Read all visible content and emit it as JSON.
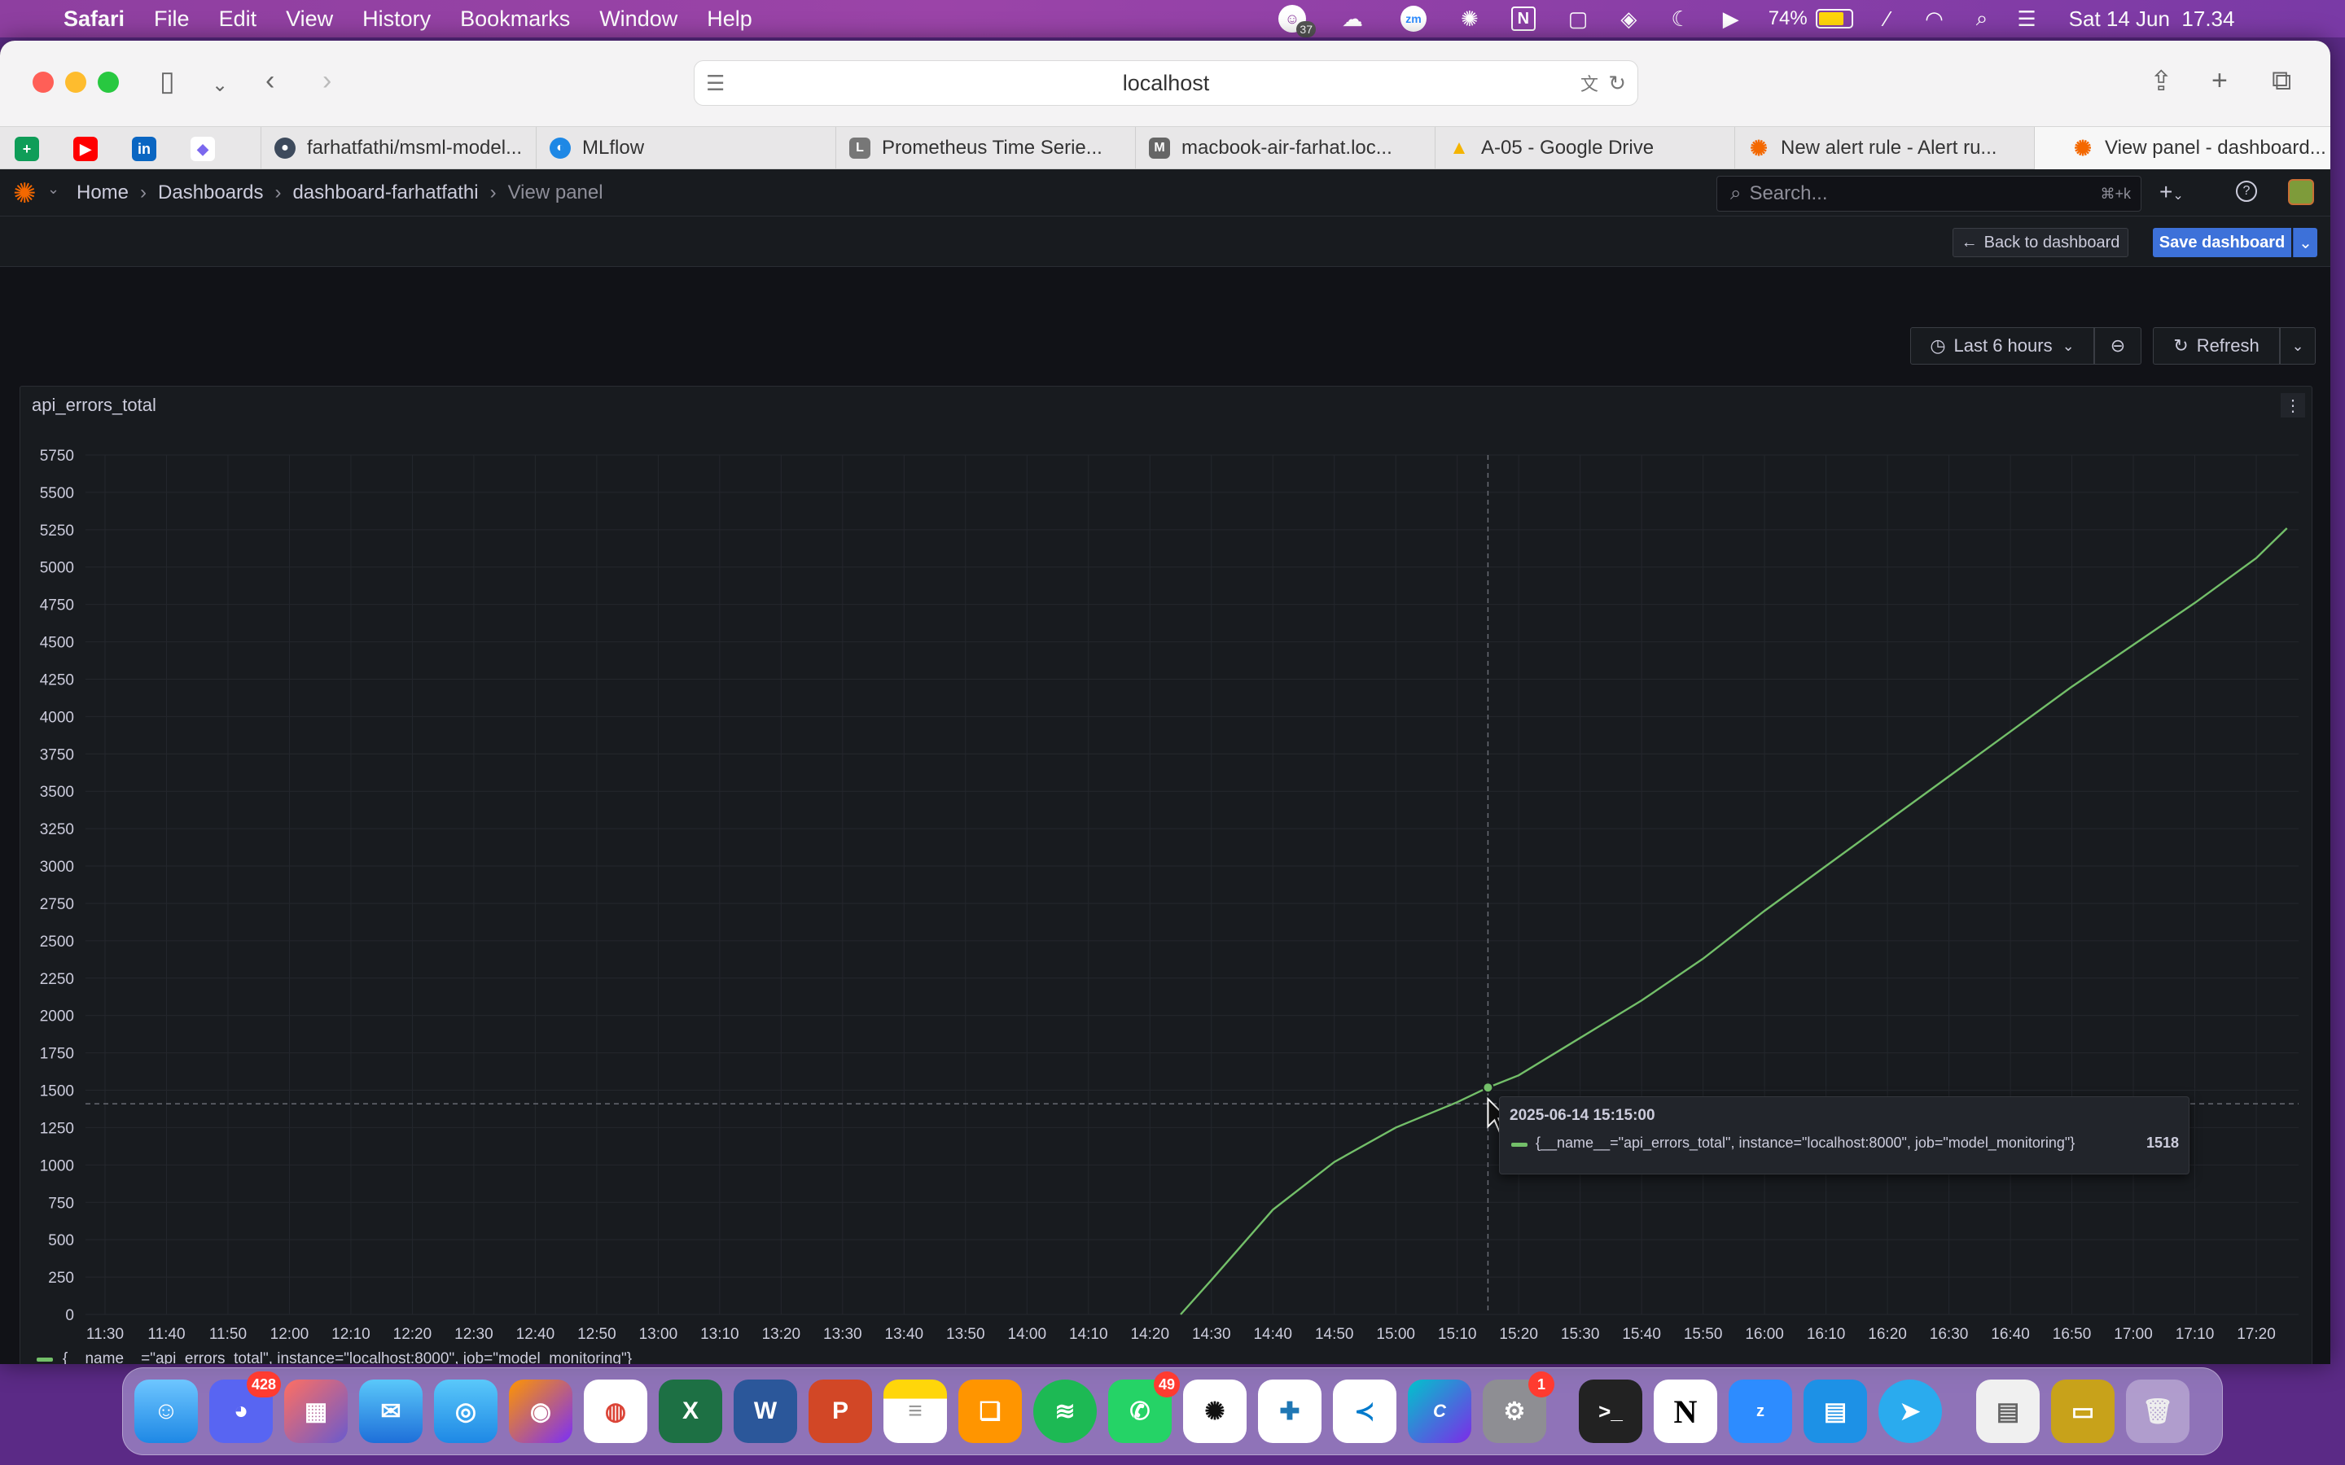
{
  "menubar": {
    "app": "Safari",
    "items": [
      "File",
      "Edit",
      "View",
      "History",
      "Bookmarks",
      "Window",
      "Help"
    ],
    "battery": "74%",
    "datetime": "Sat 14 Jun  17.34",
    "badge_count": "37"
  },
  "browser": {
    "address": "localhost",
    "tabs": [
      {
        "label": "farhatfathi/msml-model...",
        "color": "#3d4a5c"
      },
      {
        "label": "MLflow",
        "color": "#1e88e5"
      },
      {
        "label": "Prometheus Time Serie...",
        "color": "#777777"
      },
      {
        "label": "macbook-air-farhat.loc...",
        "color": "#666666"
      },
      {
        "label": "A-05 - Google Drive",
        "color": "#f4b400"
      },
      {
        "label": "New alert rule - Alert ru...",
        "color": "#f46800"
      },
      {
        "label": "View panel - dashboard...",
        "color": "#f46800"
      }
    ],
    "tab_initials": {
      "prometheus": "L",
      "macbook": "M"
    }
  },
  "grafana": {
    "breadcrumb": [
      "Home",
      "Dashboards",
      "dashboard-farhatfathi",
      "View panel"
    ],
    "search_placeholder": "Search...",
    "search_shortcut": "⌘+k",
    "back_label": "Back to dashboard",
    "save_label": "Save dashboard",
    "time_range": "Last 6 hours",
    "refresh_label": "Refresh",
    "panel_title": "api_errors_total"
  },
  "tooltip": {
    "time": "2025-06-14 15:15:00",
    "series": "{__name__=\"api_errors_total\", instance=\"localhost:8000\", job=\"model_monitoring\"}",
    "value": "1518"
  },
  "chart_data": {
    "type": "line",
    "title": "api_errors_total",
    "series_name": "{__name__=\"api_errors_total\", instance=\"localhost:8000\", job=\"model_monitoring\"}",
    "color": "#73bf69",
    "x_ticks": [
      "11:30",
      "11:40",
      "11:50",
      "12:00",
      "12:10",
      "12:20",
      "12:30",
      "12:40",
      "12:50",
      "13:00",
      "13:10",
      "13:20",
      "13:30",
      "13:40",
      "13:50",
      "14:00",
      "14:10",
      "14:20",
      "14:30",
      "14:40",
      "14:50",
      "15:00",
      "15:10",
      "15:20",
      "15:30",
      "15:40",
      "15:50",
      "16:00",
      "16:10",
      "16:20",
      "16:30",
      "16:40",
      "16:50",
      "17:00",
      "17:10",
      "17:20"
    ],
    "y_ticks": [
      0,
      250,
      500,
      750,
      1000,
      1250,
      1500,
      1750,
      2000,
      2250,
      2500,
      2750,
      3000,
      3250,
      3500,
      3750,
      4000,
      4250,
      4500,
      4750,
      5000,
      5250,
      5500,
      5750
    ],
    "ylim": [
      0,
      5750
    ],
    "x": [
      "14:25",
      "14:30",
      "14:40",
      "14:50",
      "15:00",
      "15:10",
      "15:15",
      "15:20",
      "15:30",
      "15:40",
      "15:50",
      "16:00",
      "16:10",
      "16:20",
      "16:30",
      "16:40",
      "16:50",
      "17:00",
      "17:10",
      "17:20",
      "17:25"
    ],
    "y": [
      0,
      230,
      700,
      1020,
      1250,
      1420,
      1518,
      1600,
      1850,
      2100,
      2380,
      2700,
      3000,
      3300,
      3600,
      3900,
      4200,
      4480,
      4760,
      5060,
      5260
    ],
    "grid": true,
    "legend": "bottom-left",
    "hover_x": "15:15"
  },
  "dock": {
    "discord_badge": "428",
    "whatsapp_badge": "49",
    "settings_badge": "1"
  }
}
